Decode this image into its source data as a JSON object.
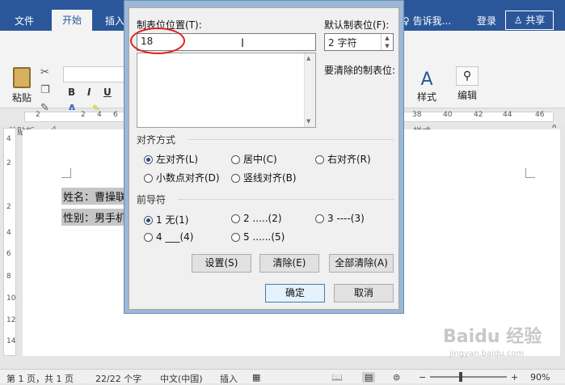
{
  "menubar": {
    "file": "文件",
    "home": "开始",
    "insert": "插入",
    "tell_me": "告诉我...",
    "login": "登录",
    "share": "共享"
  },
  "ribbon": {
    "paste": "粘贴",
    "clipboard_group": "剪贴板",
    "bold": "B",
    "italic": "I",
    "underline": "U",
    "styles": "样式",
    "styles_group": "样式",
    "editing": "编辑"
  },
  "ruler": {
    "numbers": [
      "2",
      "2",
      "4",
      "6",
      "38",
      "40",
      "42",
      "44",
      "46",
      "48"
    ]
  },
  "vruler": {
    "numbers": [
      "4",
      "2",
      "2",
      "4",
      "6",
      "8",
      "10",
      "12",
      "14"
    ]
  },
  "document": {
    "line1": "姓名：曹操联",
    "line2": "性别：男手机"
  },
  "dialog": {
    "tab_position_label": "制表位位置(T):",
    "tab_position_value": "18",
    "default_tab_label": "默认制表位(F):",
    "default_tab_value": "2 字符",
    "clear_label": "要清除的制表位:",
    "alignment_section": "对齐方式",
    "alignment": [
      {
        "label": "左对齐(L)",
        "selected": true
      },
      {
        "label": "居中(C)",
        "selected": false
      },
      {
        "label": "右对齐(R)",
        "selected": false
      },
      {
        "label": "小数点对齐(D)",
        "selected": false
      },
      {
        "label": "竖线对齐(B)",
        "selected": false
      }
    ],
    "leader_section": "前导符",
    "leader": [
      {
        "label": "1 无(1)",
        "selected": true
      },
      {
        "label": "2 .....(2)",
        "selected": false
      },
      {
        "label": "3 ----(3)",
        "selected": false
      },
      {
        "label": "4 ___(4)",
        "selected": false
      },
      {
        "label": "5 ......(5)",
        "selected": false
      }
    ],
    "set_button": "设置(S)",
    "clear_button": "清除(E)",
    "clear_all_button": "全部清除(A)",
    "ok_button": "确定",
    "cancel_button": "取消"
  },
  "statusbar": {
    "page": "第 1 页，共 1 页",
    "words": "22/22 个字",
    "language": "中文(中国)",
    "mode": "插入",
    "zoom": "90%",
    "zoom_minus": "−",
    "zoom_plus": "+"
  },
  "watermark": {
    "brand": "Baidu 经验",
    "url": "jingyan.baidu.com"
  },
  "colors": {
    "titlebar": "#2b579a",
    "highlight_circle": "#e02020"
  }
}
